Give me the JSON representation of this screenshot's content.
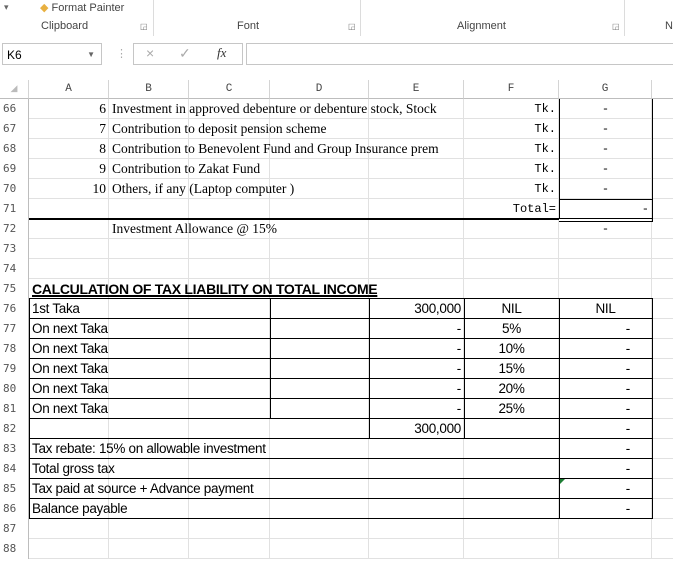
{
  "ribbon": {
    "format_painter": "Format Painter",
    "groups": [
      "Clipboard",
      "Font",
      "Alignment",
      "N"
    ]
  },
  "formula_bar": {
    "name_box": "K6",
    "cancel_icon": "×",
    "enter_icon": "✓",
    "fx_label": "fx",
    "formula": ""
  },
  "columns": [
    "A",
    "B",
    "C",
    "D",
    "E",
    "F",
    "G"
  ],
  "rows": [
    {
      "n": "66",
      "cells": {
        "A": "6",
        "B": "Investment in approved debenture or debenture stock, Stock",
        "F": "Tk.",
        "G": "-"
      }
    },
    {
      "n": "67",
      "cells": {
        "A": "7",
        "B": "Contribution to deposit pension scheme",
        "F": "Tk.",
        "G": "-"
      }
    },
    {
      "n": "68",
      "cells": {
        "A": "8",
        "B": "Contribution to Benevolent Fund and Group Insurance prem",
        "F": "Tk.",
        "G": "-"
      }
    },
    {
      "n": "69",
      "cells": {
        "A": "9",
        "B": "Contribution to Zakat Fund",
        "F": "Tk.",
        "G": "-"
      }
    },
    {
      "n": "70",
      "cells": {
        "A": "10",
        "B": "Others, if any (Laptop computer )",
        "F": "Tk.",
        "G": "-"
      }
    },
    {
      "n": "71",
      "cells": {
        "F": "Total=",
        "G": "-"
      }
    },
    {
      "n": "72",
      "cells": {
        "B": "Investment Allowance  @ 15%",
        "G": "-"
      }
    },
    {
      "n": "73",
      "cells": {}
    },
    {
      "n": "74",
      "cells": {}
    },
    {
      "n": "75",
      "cells": {
        "A": "CALCULATION OF TAX  LIABILITY ON  TOTAL INCOME"
      }
    },
    {
      "n": "76",
      "cells": {
        "A": "1st Taka",
        "E": "300,000",
        "F": "NIL",
        "G": "NIL"
      }
    },
    {
      "n": "77",
      "cells": {
        "A": "On next  Taka",
        "E": "-",
        "F": "5%",
        "G": "-"
      }
    },
    {
      "n": "78",
      "cells": {
        "A": "On next  Taka",
        "E": "-",
        "F": "10%",
        "G": "-"
      }
    },
    {
      "n": "79",
      "cells": {
        "A": "On next  Taka",
        "E": "-",
        "F": "15%",
        "G": "-"
      }
    },
    {
      "n": "80",
      "cells": {
        "A": "On next  Taka",
        "E": "-",
        "F": "20%",
        "G": "-"
      }
    },
    {
      "n": "81",
      "cells": {
        "A": "On next  Taka",
        "E": "-",
        "F": "25%",
        "G": "-"
      }
    },
    {
      "n": "82",
      "cells": {
        "E": "300,000",
        "G": "-"
      }
    },
    {
      "n": "83",
      "cells": {
        "A": "Tax rebate: 15% on allowable investment",
        "G": "-"
      }
    },
    {
      "n": "84",
      "cells": {
        "A": "Total gross tax",
        "G": "-"
      }
    },
    {
      "n": "85",
      "cells": {
        "A": "Tax paid  at source + Advance payment",
        "G": "-"
      }
    },
    {
      "n": "86",
      "cells": {
        "A": "Balance payable",
        "G": "-"
      }
    },
    {
      "n": "87",
      "cells": {}
    },
    {
      "n": "88",
      "cells": {}
    }
  ]
}
